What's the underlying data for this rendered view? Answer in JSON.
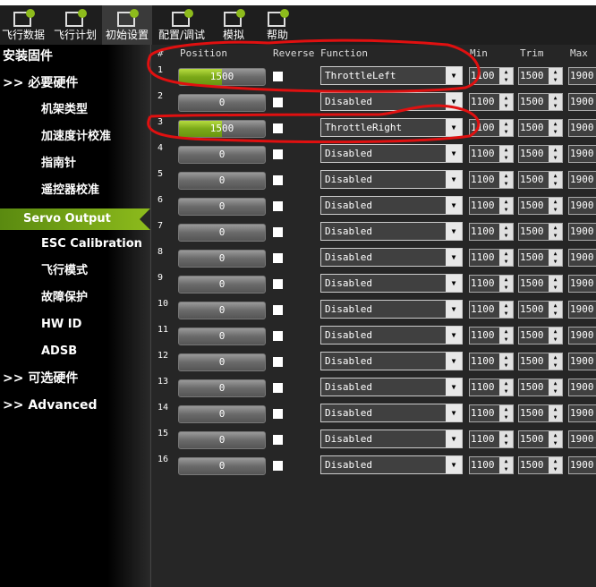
{
  "topbar": [
    {
      "label": "飞行数据",
      "icon": "flight-data-icon"
    },
    {
      "label": "飞行计划",
      "icon": "flight-plan-icon"
    },
    {
      "label": "初始设置",
      "icon": "initial-setup-icon",
      "active": true
    },
    {
      "label": "配置/调试",
      "icon": "config-tuning-icon"
    },
    {
      "label": "模拟",
      "icon": "simulation-icon"
    },
    {
      "label": "帮助",
      "icon": "help-icon"
    }
  ],
  "sidebar": [
    {
      "label": "安装固件",
      "kind": "top"
    },
    {
      "label": ">> 必要硬件",
      "kind": "top"
    },
    {
      "label": "机架类型",
      "kind": "sub"
    },
    {
      "label": "加速度计校准",
      "kind": "sub"
    },
    {
      "label": "指南针",
      "kind": "sub"
    },
    {
      "label": "遥控器校准",
      "kind": "sub"
    },
    {
      "label": "Servo Output",
      "kind": "sel"
    },
    {
      "label": "ESC Calibration",
      "kind": "sub"
    },
    {
      "label": "飞行模式",
      "kind": "sub"
    },
    {
      "label": "故障保护",
      "kind": "sub"
    },
    {
      "label": "HW ID",
      "kind": "sub"
    },
    {
      "label": "ADSB",
      "kind": "sub"
    },
    {
      "label": ">> 可选硬件",
      "kind": "top"
    },
    {
      "label": ">> Advanced",
      "kind": "top"
    }
  ],
  "headers": {
    "num": "#",
    "position": "Position",
    "reverse": "Reverse",
    "function": "Function",
    "min": "Min",
    "trim": "Trim",
    "max": "Max"
  },
  "rows": [
    {
      "n": "1",
      "pos": "1500",
      "fill": 0.5,
      "func": "ThrottleLeft",
      "min": "1100",
      "trim": "1500",
      "max": "1900"
    },
    {
      "n": "2",
      "pos": "0",
      "fill": 0,
      "func": "Disabled",
      "min": "1100",
      "trim": "1500",
      "max": "1900"
    },
    {
      "n": "3",
      "pos": "1500",
      "fill": 0.5,
      "func": "ThrottleRight",
      "min": "1100",
      "trim": "1500",
      "max": "1900"
    },
    {
      "n": "4",
      "pos": "0",
      "fill": 0,
      "func": "Disabled",
      "min": "1100",
      "trim": "1500",
      "max": "1900"
    },
    {
      "n": "5",
      "pos": "0",
      "fill": 0,
      "func": "Disabled",
      "min": "1100",
      "trim": "1500",
      "max": "1900"
    },
    {
      "n": "6",
      "pos": "0",
      "fill": 0,
      "func": "Disabled",
      "min": "1100",
      "trim": "1500",
      "max": "1900"
    },
    {
      "n": "7",
      "pos": "0",
      "fill": 0,
      "func": "Disabled",
      "min": "1100",
      "trim": "1500",
      "max": "1900"
    },
    {
      "n": "8",
      "pos": "0",
      "fill": 0,
      "func": "Disabled",
      "min": "1100",
      "trim": "1500",
      "max": "1900"
    },
    {
      "n": "9",
      "pos": "0",
      "fill": 0,
      "func": "Disabled",
      "min": "1100",
      "trim": "1500",
      "max": "1900"
    },
    {
      "n": "10",
      "pos": "0",
      "fill": 0,
      "func": "Disabled",
      "min": "1100",
      "trim": "1500",
      "max": "1900"
    },
    {
      "n": "11",
      "pos": "0",
      "fill": 0,
      "func": "Disabled",
      "min": "1100",
      "trim": "1500",
      "max": "1900"
    },
    {
      "n": "12",
      "pos": "0",
      "fill": 0,
      "func": "Disabled",
      "min": "1100",
      "trim": "1500",
      "max": "1900"
    },
    {
      "n": "13",
      "pos": "0",
      "fill": 0,
      "func": "Disabled",
      "min": "1100",
      "trim": "1500",
      "max": "1900"
    },
    {
      "n": "14",
      "pos": "0",
      "fill": 0,
      "func": "Disabled",
      "min": "1100",
      "trim": "1500",
      "max": "1900"
    },
    {
      "n": "15",
      "pos": "0",
      "fill": 0,
      "func": "Disabled",
      "min": "1100",
      "trim": "1500",
      "max": "1900"
    },
    {
      "n": "16",
      "pos": "0",
      "fill": 0,
      "func": "Disabled",
      "min": "1100",
      "trim": "1500",
      "max": "1900"
    }
  ],
  "colors": {
    "accent": "#8dbb1c",
    "annotation": "#e01010"
  }
}
